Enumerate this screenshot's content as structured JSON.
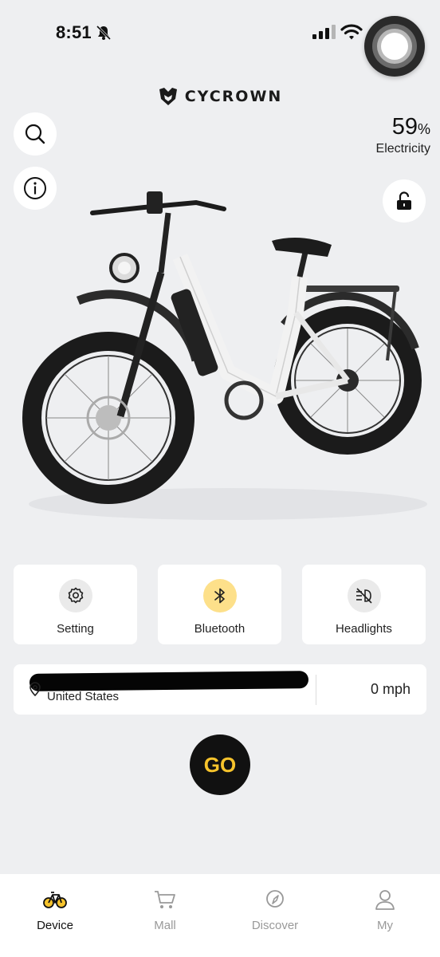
{
  "status_bar": {
    "time": "8:51"
  },
  "brand": {
    "name": "CYCROWN"
  },
  "battery": {
    "percent": "59",
    "unit": "%",
    "label": "Electricity"
  },
  "actions": [
    {
      "label": "Setting",
      "icon": "gear-icon",
      "active": false
    },
    {
      "label": "Bluetooth",
      "icon": "bluetooth-icon",
      "active": true
    },
    {
      "label": "Headlights",
      "icon": "headlight-off-icon",
      "active": false
    }
  ],
  "location": {
    "country": "United States",
    "speed": "0 mph"
  },
  "go_button": {
    "label": "GO"
  },
  "tabs": [
    {
      "label": "Device",
      "icon": "bike-icon",
      "active": true
    },
    {
      "label": "Mall",
      "icon": "cart-icon",
      "active": false
    },
    {
      "label": "Discover",
      "icon": "compass-icon",
      "active": false
    },
    {
      "label": "My",
      "icon": "user-icon",
      "active": false
    }
  ],
  "colors": {
    "accent": "#f6c32c",
    "background": "#eeeff1",
    "active_icon_bg": "#fde08a"
  }
}
